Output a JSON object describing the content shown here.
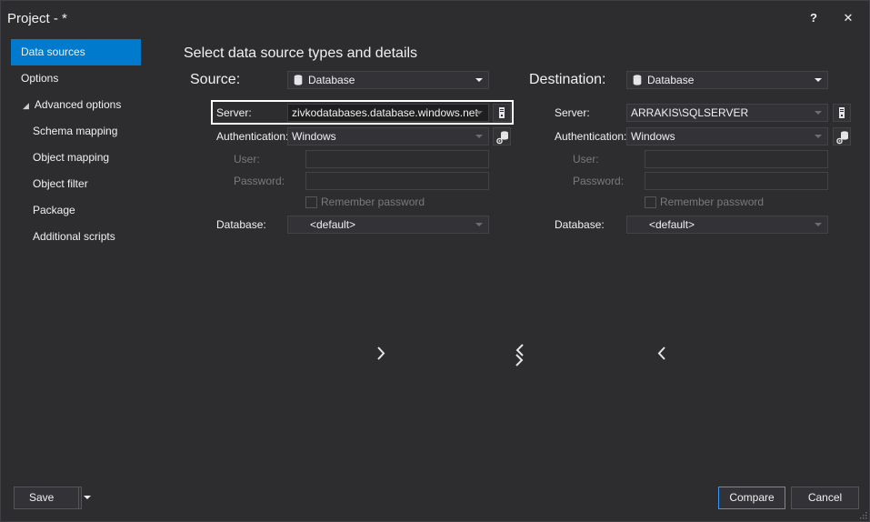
{
  "window": {
    "title": "Project - *",
    "help_label": "?",
    "close_label": "✕"
  },
  "nav": {
    "items": [
      {
        "label": "Data sources",
        "active": true
      },
      {
        "label": "Options"
      },
      {
        "label": "Advanced options",
        "expanded": true
      },
      {
        "label": "Schema mapping"
      },
      {
        "label": "Object mapping"
      },
      {
        "label": "Object filter"
      },
      {
        "label": "Package"
      },
      {
        "label": "Additional scripts"
      }
    ]
  },
  "main": {
    "heading": "Select data source types and details"
  },
  "source": {
    "label": "Source:",
    "type": "Database",
    "server_label": "Server:",
    "server": "zivkodatabases.database.windows.net",
    "auth_label": "Authentication:",
    "auth": "Windows",
    "user_label": "User:",
    "password_label": "Password:",
    "remember_label": "Remember password",
    "database_label": "Database:",
    "database": "<default>"
  },
  "destination": {
    "label": "Destination:",
    "type": "Database",
    "server_label": "Server:",
    "server": "ARRAKIS\\SQLSERVER",
    "auth_label": "Authentication:",
    "auth": "Windows",
    "user_label": "User:",
    "password_label": "Password:",
    "remember_label": "Remember password",
    "database_label": "Database:",
    "database": "<default>"
  },
  "footer": {
    "save_label": "Save",
    "compare_label": "Compare",
    "cancel_label": "Cancel"
  },
  "icons": {
    "copy_right": "chevron-right-icon",
    "swap": "swap-icon",
    "copy_left": "chevron-left-icon",
    "database": "database-icon",
    "server_browse": "server-icon",
    "auth_settings": "database-settings-icon"
  },
  "colors": {
    "background": "#2d2d30",
    "accent": "#007acc",
    "primary_border": "#3399ff",
    "highlight": "#ffffff"
  }
}
